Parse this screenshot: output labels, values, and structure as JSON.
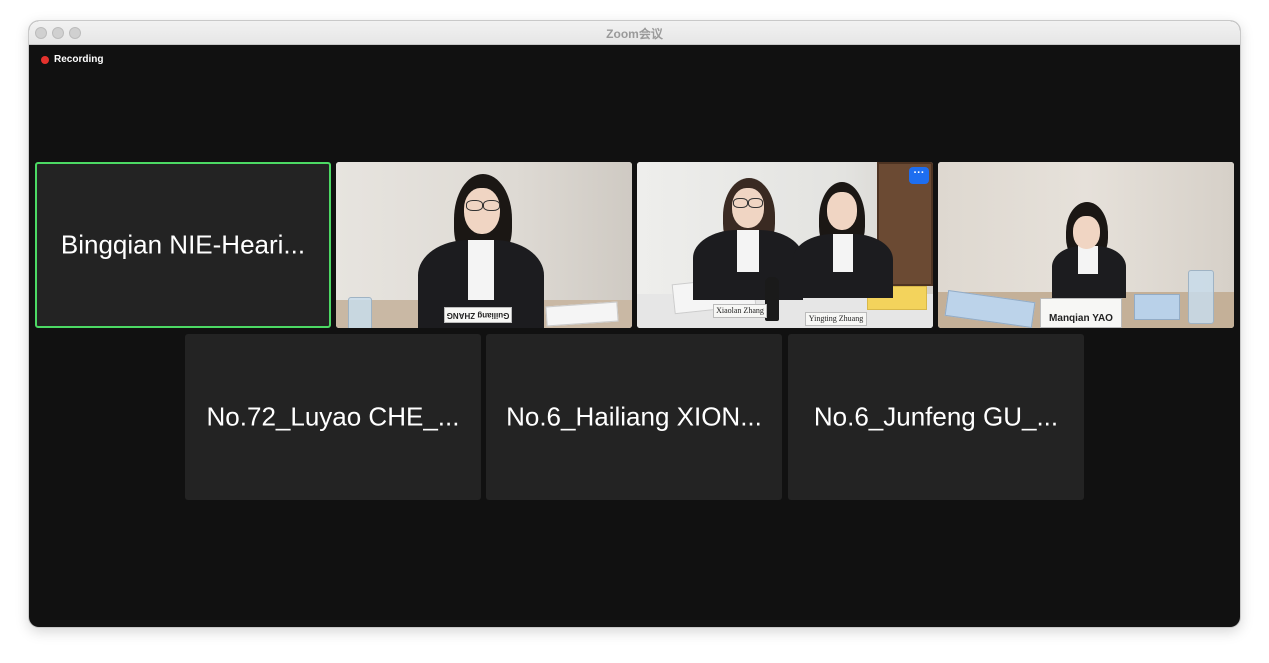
{
  "window": {
    "title": "Zoom会议"
  },
  "status": {
    "recording_label": "Recording",
    "recording_color": "#e5322d"
  },
  "colors": {
    "active_speaker_border": "#4cd964",
    "tile_background": "#232323",
    "more_button": "#1e6ef0"
  },
  "participants": [
    {
      "name": "Bingqian NIE-Heari...",
      "video": false,
      "active": true
    },
    {
      "name": "",
      "video": true,
      "nameplates": [
        "Guiliang ZHANG"
      ]
    },
    {
      "name": "",
      "video": true,
      "nameplates": [
        "Xiaolan Zhang",
        "Yingting Zhuang"
      ],
      "menu_icon": "more-dots-icon"
    },
    {
      "name": "",
      "video": true,
      "nameplates": [
        "Manqian YAO"
      ]
    },
    {
      "name": "No.72_Luyao CHE_...",
      "video": false
    },
    {
      "name": "No.6_Hailiang XION...",
      "video": false
    },
    {
      "name": "No.6_Junfeng GU_...",
      "video": false
    }
  ],
  "icons": {
    "more": "more-dots-icon",
    "more_glyph": "···"
  }
}
